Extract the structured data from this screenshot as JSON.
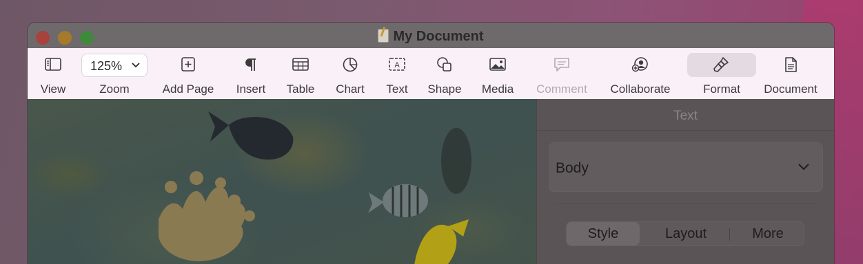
{
  "window": {
    "title": "My Document"
  },
  "toolbar": {
    "view_label": "View",
    "zoom_value": "125%",
    "zoom_label": "Zoom",
    "add_page_label": "Add Page",
    "insert_label": "Insert",
    "table_label": "Table",
    "chart_label": "Chart",
    "text_label": "Text",
    "shape_label": "Shape",
    "media_label": "Media",
    "comment_label": "Comment",
    "collaborate_label": "Collaborate",
    "format_label": "Format",
    "document_label": "Document"
  },
  "sidebar": {
    "tab_title": "Text",
    "paragraph_style": "Body",
    "segments": [
      "Style",
      "Layout",
      "More"
    ]
  },
  "colors": {
    "toolbar_bg": "#faf0f7",
    "dimmed_overlay": "#5a5456"
  }
}
